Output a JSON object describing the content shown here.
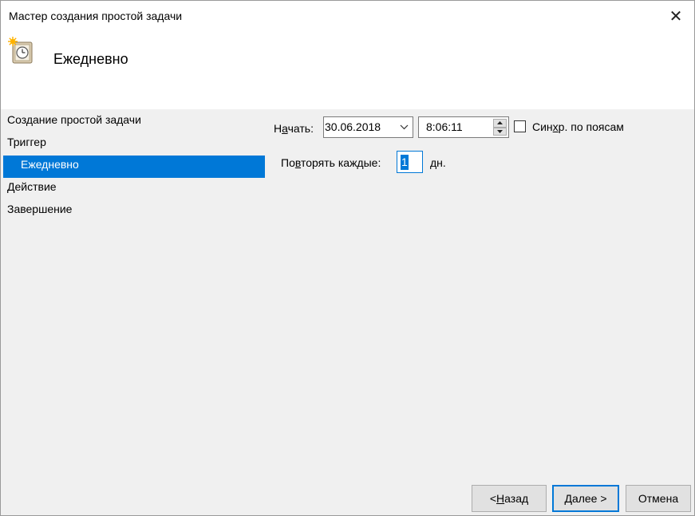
{
  "window": {
    "title": "Мастер создания простой задачи",
    "close_glyph": "✕"
  },
  "header": {
    "title": "Ежедневно",
    "icon": "task-clock-icon"
  },
  "steps": [
    {
      "label": "Создание простой задачи",
      "selected": false
    },
    {
      "label": "Триггер",
      "selected": false
    },
    {
      "label": "Ежедневно",
      "selected": true
    },
    {
      "label": "Действие",
      "selected": false
    },
    {
      "label": "Завершение",
      "selected": false
    }
  ],
  "form": {
    "start_label_pre": "Н",
    "start_label_acc": "а",
    "start_label_post": "чать:",
    "date_value": "30.06.2018",
    "time_value": "8:06:11",
    "sync_label_pre": "Син",
    "sync_label_acc": "х",
    "sync_label_post": "р. по поясам",
    "sync_checked": false,
    "repeat_label_pre": "По",
    "repeat_label_acc": "в",
    "repeat_label_post": "торять каждые:",
    "repeat_value": "1",
    "repeat_unit": "дн."
  },
  "buttons": {
    "back_pre": "< ",
    "back_acc": "Н",
    "back_post": "азад",
    "next_pre": "",
    "next_acc": "Д",
    "next_post": "алее >",
    "cancel": "Отмена"
  },
  "colors": {
    "accent": "#0078d7"
  }
}
